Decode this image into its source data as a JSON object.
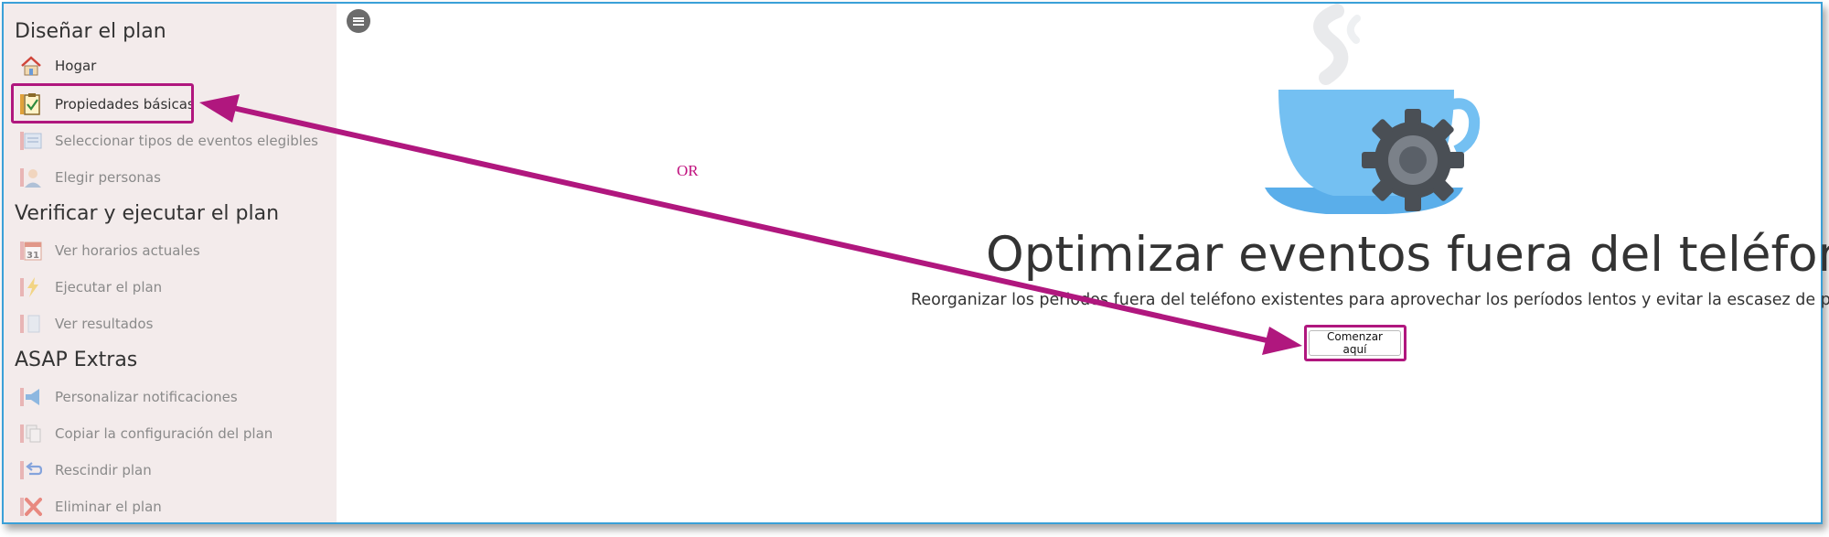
{
  "sidebar": {
    "sections": [
      {
        "title": "Diseñar el plan",
        "items": [
          {
            "label": "Hogar",
            "icon": "home-icon"
          },
          {
            "label": "Propiedades básicas",
            "icon": "clipboard-check-icon"
          },
          {
            "label": "Seleccionar tipos de eventos elegibles",
            "icon": "calendar-list-icon"
          },
          {
            "label": "Elegir personas",
            "icon": "person-icon"
          }
        ]
      },
      {
        "title": "Verificar y ejecutar el plan",
        "items": [
          {
            "label": "Ver horarios actuales",
            "icon": "calendar-icon",
            "icon_text": "31"
          },
          {
            "label": "Ejecutar el plan",
            "icon": "lightning-icon"
          },
          {
            "label": "Ver resultados",
            "icon": "document-icon"
          }
        ]
      },
      {
        "title": "ASAP Extras",
        "items": [
          {
            "label": "Personalizar notificaciones",
            "icon": "megaphone-icon"
          },
          {
            "label": "Copiar la configuración del plan",
            "icon": "copy-icon"
          },
          {
            "label": "Rescindir plan",
            "icon": "undo-icon"
          },
          {
            "label": "Eliminar el plan",
            "icon": "delete-x-icon"
          }
        ]
      }
    ]
  },
  "annotation": {
    "or_text": "OR"
  },
  "main": {
    "title": "Optimizar eventos fuera del teléfono",
    "subtitle": "Reorganizar los periodos fuera del teléfono existentes para aprovechar los períodos lentos y evitar la escasez de personal.",
    "start_button": "Comenzar aquí",
    "illustration": "coffee-cup-gear-icon"
  },
  "colors": {
    "sidebar_bg": "#f3ebeb",
    "annotation": "#c0117e",
    "frame_border": "#3aa0d8",
    "cup": "#5fb4ee",
    "gear": "#4a4f55"
  }
}
